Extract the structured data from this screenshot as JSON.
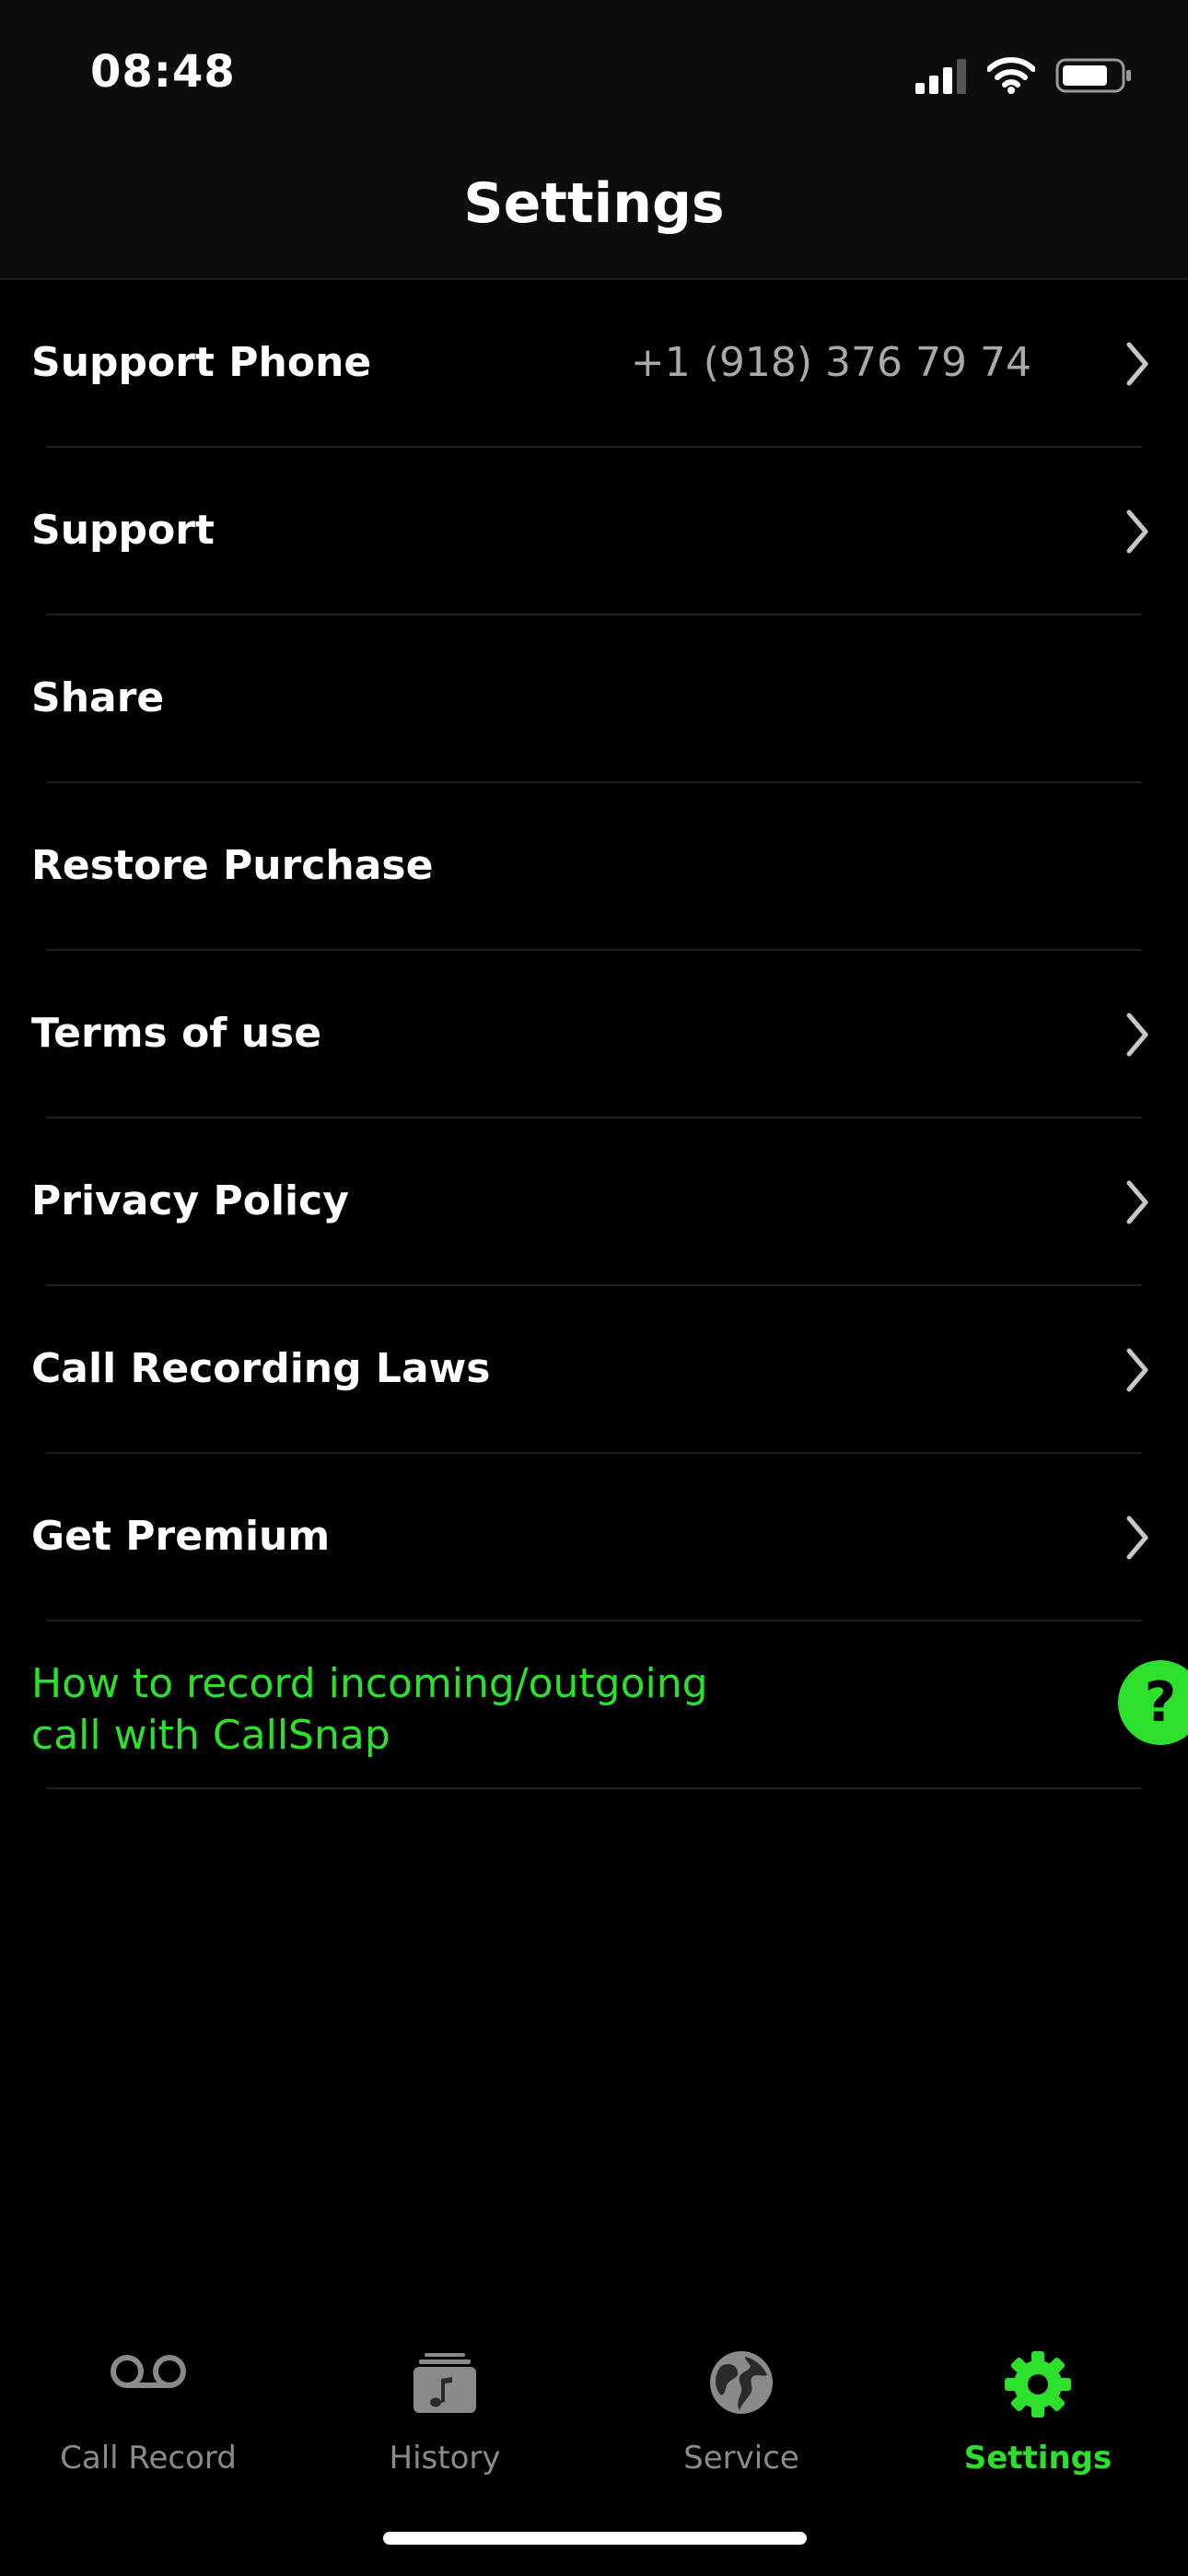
{
  "status_bar": {
    "time": "08:48",
    "icons": [
      "cellular-signal-icon",
      "wifi-icon",
      "battery-icon"
    ]
  },
  "header": {
    "title": "Settings"
  },
  "settings": {
    "items": [
      {
        "label": "Support Phone",
        "value": "+1 (918) 376 79 74",
        "chevron": true
      },
      {
        "label": "Support",
        "chevron": true
      },
      {
        "label": "Share",
        "chevron": false
      },
      {
        "label": "Restore Purchase",
        "chevron": false
      },
      {
        "label": "Terms of use",
        "chevron": true
      },
      {
        "label": "Privacy Policy",
        "chevron": true
      },
      {
        "label": "Call Recording Laws",
        "chevron": true
      },
      {
        "label": "Get Premium",
        "chevron": true
      }
    ],
    "help_link": {
      "line1": "How to record incoming/outgoing",
      "line2": "call with CallSnap",
      "icon_text": "?"
    }
  },
  "tab_bar": {
    "tabs": [
      {
        "label": "Call Record",
        "icon": "voicemail-icon",
        "active": false
      },
      {
        "label": "History",
        "icon": "music-folder-icon",
        "active": false
      },
      {
        "label": "Service",
        "icon": "globe-icon",
        "active": false
      },
      {
        "label": "Settings",
        "icon": "gear-icon",
        "active": true
      }
    ]
  },
  "colors": {
    "background": "#000000",
    "header_background": "#0d0d0d",
    "accent": "#2ce02c",
    "text_primary": "#ffffff",
    "text_secondary": "#a9a9a9",
    "tab_inactive": "#8a8a8a"
  }
}
